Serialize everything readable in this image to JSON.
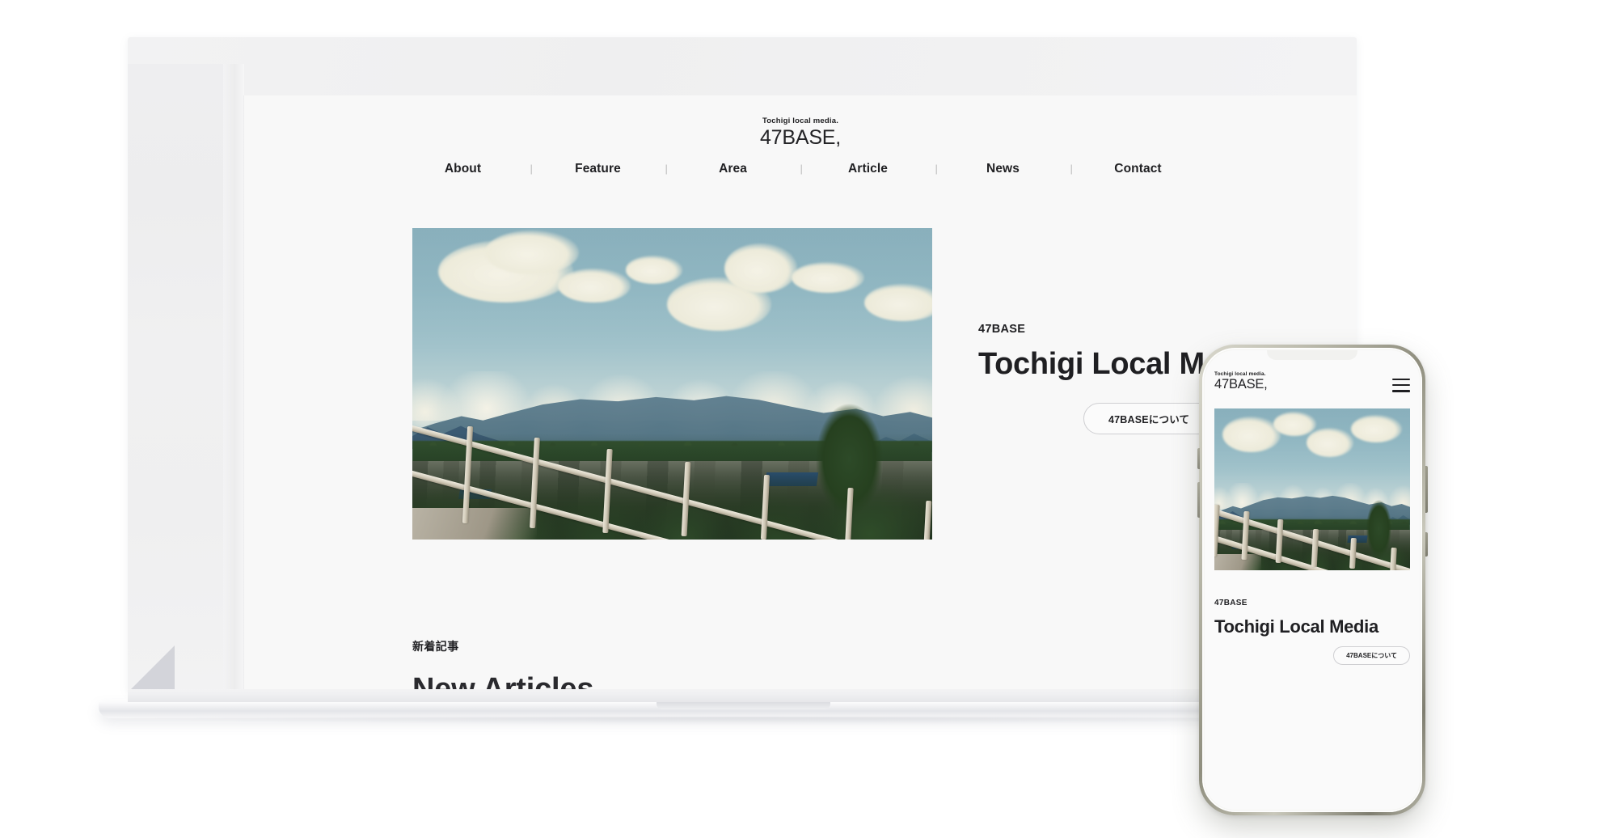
{
  "site": {
    "logo": {
      "kicker": "Tochigi local media.",
      "word": "47BASE,"
    },
    "nav": [
      {
        "label": "About"
      },
      {
        "label": "Feature"
      },
      {
        "label": "Area"
      },
      {
        "label": "Article"
      },
      {
        "label": "News"
      },
      {
        "label": "Contact"
      }
    ],
    "nav_separator": "|",
    "hero": {
      "kicker": "47BASE",
      "title": "Tochigi Local Media",
      "button_label": "47BASEについて",
      "photo_alt": "Mountain range over a Japanese town with a white railing in the foreground"
    },
    "articles": {
      "kicker": "新着記事",
      "title": "New Articles"
    }
  },
  "mobile": {
    "logo": {
      "kicker": "Tochigi local media.",
      "word": "47BASE,"
    },
    "menu_icon": "hamburger-menu-icon",
    "hero": {
      "kicker": "47BASE",
      "title": "Tochigi Local Media",
      "button_label": "47BASEについて"
    }
  },
  "devices": {
    "laptop_label": "laptop-mockup",
    "phone_label": "phone-mockup"
  },
  "colors": {
    "page_background": "#f8f8f8",
    "text_primary": "#1f1f22",
    "text_logo": "#232326",
    "button_border": "#cfcfd2",
    "nav_separator": "#bdbdbd",
    "device_bezel": "#f0f0f1",
    "phone_frame": "#8f8e7e",
    "photo_sky": "#8cb4c0",
    "photo_mountain": "#4f7080",
    "photo_foliage": "#2b4427",
    "photo_rail": "#cfc8b6"
  }
}
